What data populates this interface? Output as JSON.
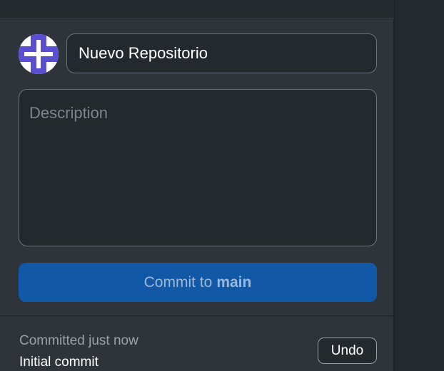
{
  "commit_form": {
    "summary_value": "Nuevo Repositorio",
    "description_placeholder": "Description",
    "commit_button_prefix": "Commit to",
    "branch": "main"
  },
  "last_commit": {
    "status": "Committed just now",
    "message": "Initial commit",
    "undo_label": "Undo"
  },
  "avatar": {
    "icon": "identicon-avatar",
    "color": "#5a4fd1"
  },
  "colors": {
    "panel": "#2f343b",
    "background": "#24292e",
    "primary_button": "#1158a7"
  }
}
